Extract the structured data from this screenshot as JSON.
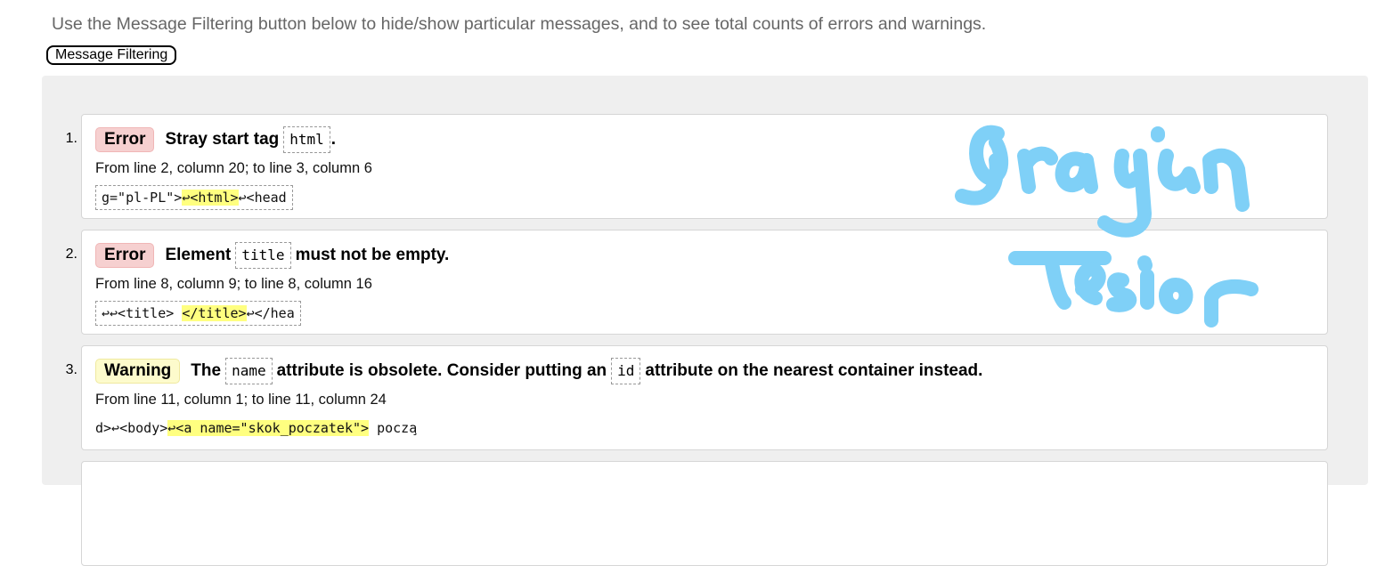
{
  "intro_text": "Use the Message Filtering button below to hide/show particular messages, and to see total counts of errors and warnings.",
  "filter_button_label": "Message Filtering",
  "messages": [
    {
      "number": "1.",
      "type": "Error",
      "text_before": "Stray start tag",
      "code": "html",
      "text_after": ".",
      "location": "From line 2, column 20; to line 3, column 6",
      "extract_before": "g=\"pl-PL\">",
      "extract_highlight": "↩<html>",
      "extract_after": "↩<head"
    },
    {
      "number": "2.",
      "type": "Error",
      "text_before": "Element",
      "code": "title",
      "text_after": "must not be empty.",
      "location": "From line 8, column 9; to line 8, column 16",
      "extract_before": "↩↩<title> ",
      "extract_highlight": "</title>",
      "extract_after": "↩</hea"
    },
    {
      "number": "3.",
      "type": "Warning",
      "text_before": "The",
      "code": "name",
      "text_middle": "attribute is obsolete. Consider putting an",
      "code2": "id",
      "text_after": "attribute on the nearest container instead.",
      "location": "From line 11, column 1; to line 11, column 24",
      "extract_before": "d>↩<body>",
      "extract_highlight": "↩<a name=\"skok_poczatek\">",
      "extract_after": " pocza̧"
    }
  ],
  "colors": {
    "error_badge": "#f6d0d0",
    "warning_badge": "#fdfbcc",
    "highlight": "#ffff80",
    "panel": "#efefef",
    "signature": "#7fd0f7"
  }
}
